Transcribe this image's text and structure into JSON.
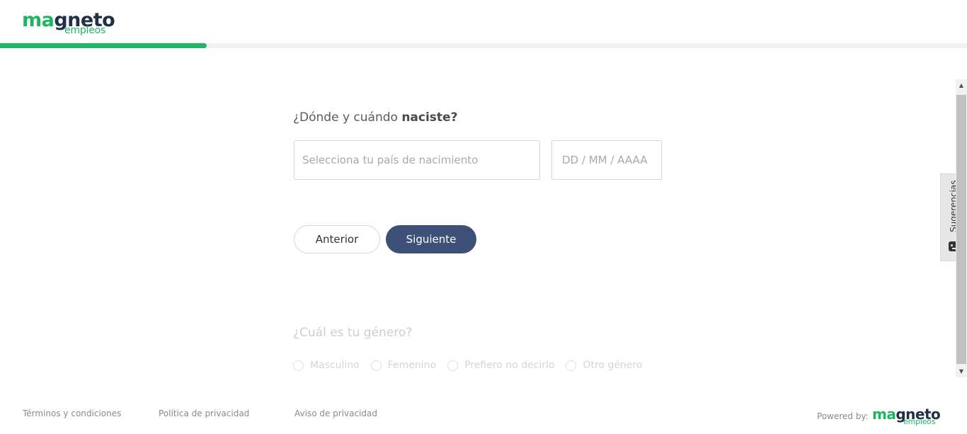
{
  "brand": {
    "logo_main_green": "ma",
    "logo_main_dark": "gneto",
    "logo_sub": "empleos",
    "accent_color": "#1fb563",
    "dark_color": "#203046"
  },
  "progress": {
    "fraction": 0.214
  },
  "birth_question": {
    "text_prefix": "¿Dónde y cuándo ",
    "text_bold": "naciste?",
    "country_placeholder": "Selecciona tu país de nacimiento",
    "date_placeholder": "DD / MM / AAAA"
  },
  "buttons": {
    "previous": "Anterior",
    "next": "Siguiente",
    "next_color": "#3c5078"
  },
  "gender_question": {
    "text": "¿Cuál es tu género?",
    "options": [
      "Masculino",
      "Femenino",
      "Prefiero no decirlo",
      "Otro género"
    ]
  },
  "footer": {
    "terms": "Términos y condiciones",
    "privacy_policy": "Política de privacidad",
    "privacy_notice": "Aviso de privacidad",
    "powered_by": "Powered by:"
  },
  "feedback_tab": {
    "label": "Sugerencias",
    "icon": "feedback-face-icon"
  }
}
